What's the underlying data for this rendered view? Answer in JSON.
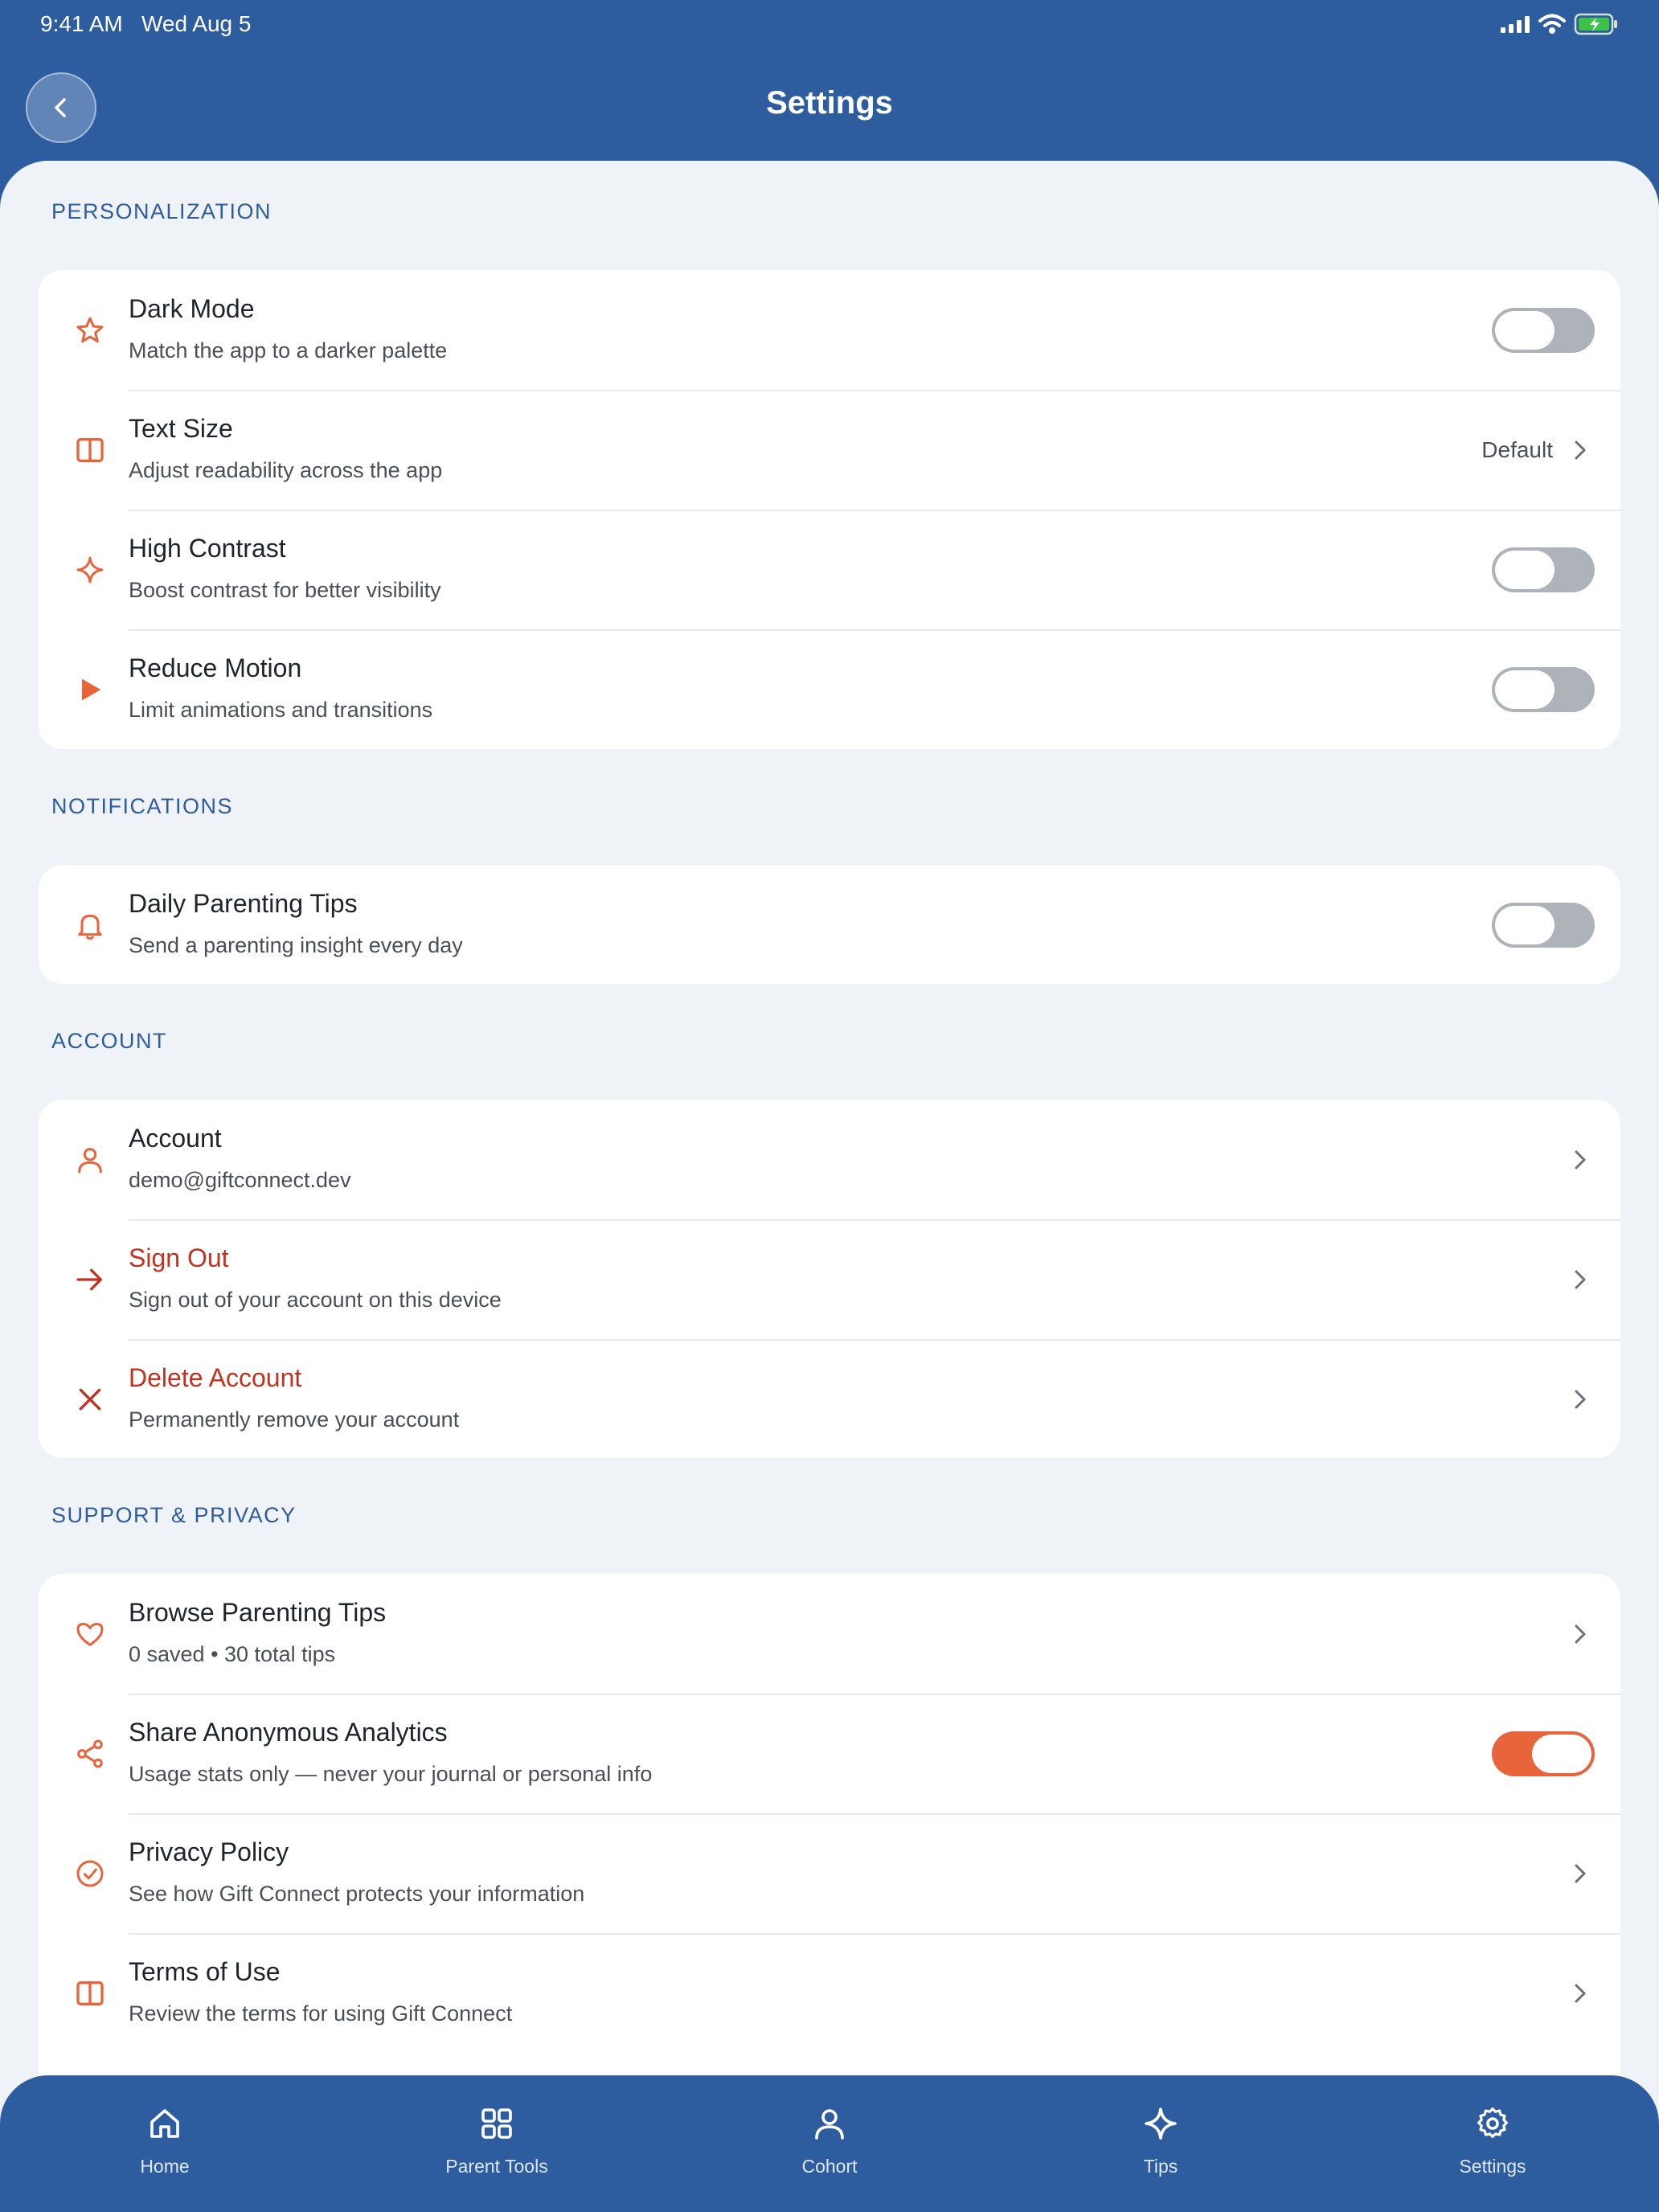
{
  "status_bar": {
    "time": "9:41 AM",
    "date": "Wed Aug 5"
  },
  "header": {
    "title": "Settings",
    "back_icon": "chevron-left-icon"
  },
  "colors": {
    "brand": "#2d5c9f",
    "accent": "#e8653c",
    "danger": "#c2321f",
    "background": "#eff3f8"
  },
  "sections": {
    "personalization": {
      "title": "PERSONALIZATION",
      "dark_mode": {
        "title": "Dark Mode",
        "subtitle": "Match the app to a darker palette",
        "icon": "star-icon",
        "enabled": false
      },
      "text_size": {
        "title": "Text Size",
        "subtitle": "Adjust readability across the app",
        "icon": "book-icon",
        "value": "Default"
      },
      "high_contrast": {
        "title": "High Contrast",
        "subtitle": "Boost contrast for better visibility",
        "icon": "sparkle-icon",
        "enabled": false
      },
      "reduce_motion": {
        "title": "Reduce Motion",
        "subtitle": "Limit animations and transitions",
        "icon": "play-icon",
        "enabled": false
      }
    },
    "notifications": {
      "title": "NOTIFICATIONS",
      "daily_tips": {
        "title": "Daily Parenting Tips",
        "subtitle": "Send a parenting insight every day",
        "icon": "bell-icon",
        "enabled": false
      }
    },
    "account": {
      "title": "ACCOUNT",
      "account": {
        "title": "Account",
        "subtitle": "demo@giftconnect.dev",
        "icon": "user-icon"
      },
      "sign_out": {
        "title": "Sign Out",
        "subtitle": "Sign out of your account on this device",
        "icon": "arrow-right-icon"
      },
      "delete_account": {
        "title": "Delete Account",
        "subtitle": "Permanently remove your account",
        "icon": "x-icon"
      }
    },
    "support": {
      "title": "SUPPORT & PRIVACY",
      "browse_tips": {
        "title": "Browse Parenting Tips",
        "subtitle": "0 saved • 30 total tips",
        "icon": "heart-icon"
      },
      "analytics": {
        "title": "Share Anonymous Analytics",
        "subtitle": "Usage stats only — never your journal or personal info",
        "icon": "share-icon",
        "enabled": true
      },
      "privacy": {
        "title": "Privacy Policy",
        "subtitle": "See how Gift Connect protects your information",
        "icon": "check-circle-icon"
      },
      "terms": {
        "title": "Terms of Use",
        "subtitle": "Review the terms for using Gift Connect",
        "icon": "book-icon"
      }
    }
  },
  "tab_bar": {
    "home": {
      "label": "Home",
      "icon": "home-icon"
    },
    "parent_tools": {
      "label": "Parent Tools",
      "icon": "grid-icon"
    },
    "cohort": {
      "label": "Cohort",
      "icon": "person-icon"
    },
    "tips": {
      "label": "Tips",
      "icon": "sparkle-icon"
    },
    "settings": {
      "label": "Settings",
      "icon": "gear-icon"
    }
  }
}
